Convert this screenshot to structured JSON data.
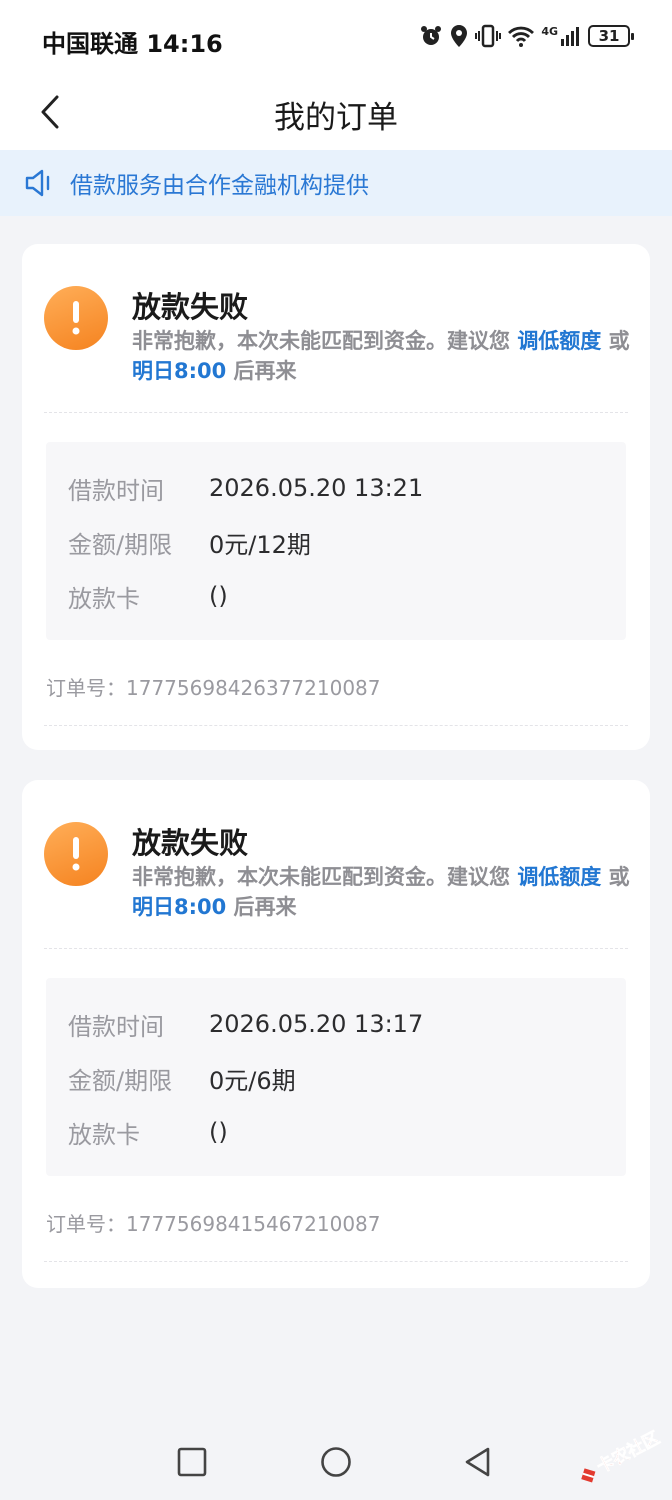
{
  "status_bar": {
    "carrier_time": "中国联通 14:16",
    "network_tag": "4G",
    "battery": "31"
  },
  "header": {
    "title": "我的订单"
  },
  "notice": {
    "text": "借款服务由合作金融机构提供"
  },
  "orders": [
    {
      "status": "放款失败",
      "message_part1": "非常抱歉，本次未能匹配到资金。建议您 ",
      "link_lower_limit": "调低额度",
      "message_part2": " 或 ",
      "link_tomorrow": "明日8:00",
      "message_part3": " 后再来",
      "borrow_time_label": "借款时间",
      "borrow_time": "2026.05.20 13:21",
      "amount_label": "金额/期限",
      "amount": "0元/12期",
      "card_label": "放款卡",
      "card": "()",
      "order_no_label": "订单号：",
      "order_no": "17775698426377210087"
    },
    {
      "status": "放款失败",
      "message_part1": "非常抱歉，本次未能匹配到资金。建议您 ",
      "link_lower_limit": "调低额度",
      "message_part2": " 或 ",
      "link_tomorrow": "明日8:00",
      "message_part3": " 后再来",
      "borrow_time_label": "借款时间",
      "borrow_time": "2026.05.20 13:17",
      "amount_label": "金额/期限",
      "amount": "0元/6期",
      "card_label": "放款卡",
      "card": "()",
      "order_no_label": "订单号：",
      "order_no": "17775698415467210087"
    }
  ],
  "watermark": {
    "text": "卡农社区"
  },
  "colors": {
    "accent": "#2277d2",
    "warning": "#f58320",
    "notice_bg": "#e8f2fc"
  },
  "icons": {
    "back": "chevron-left-icon",
    "notice": "speaker-icon",
    "status": "exclamation-icon",
    "nav_recent": "square-icon",
    "nav_home": "circle-icon",
    "nav_back": "triangle-icon"
  }
}
